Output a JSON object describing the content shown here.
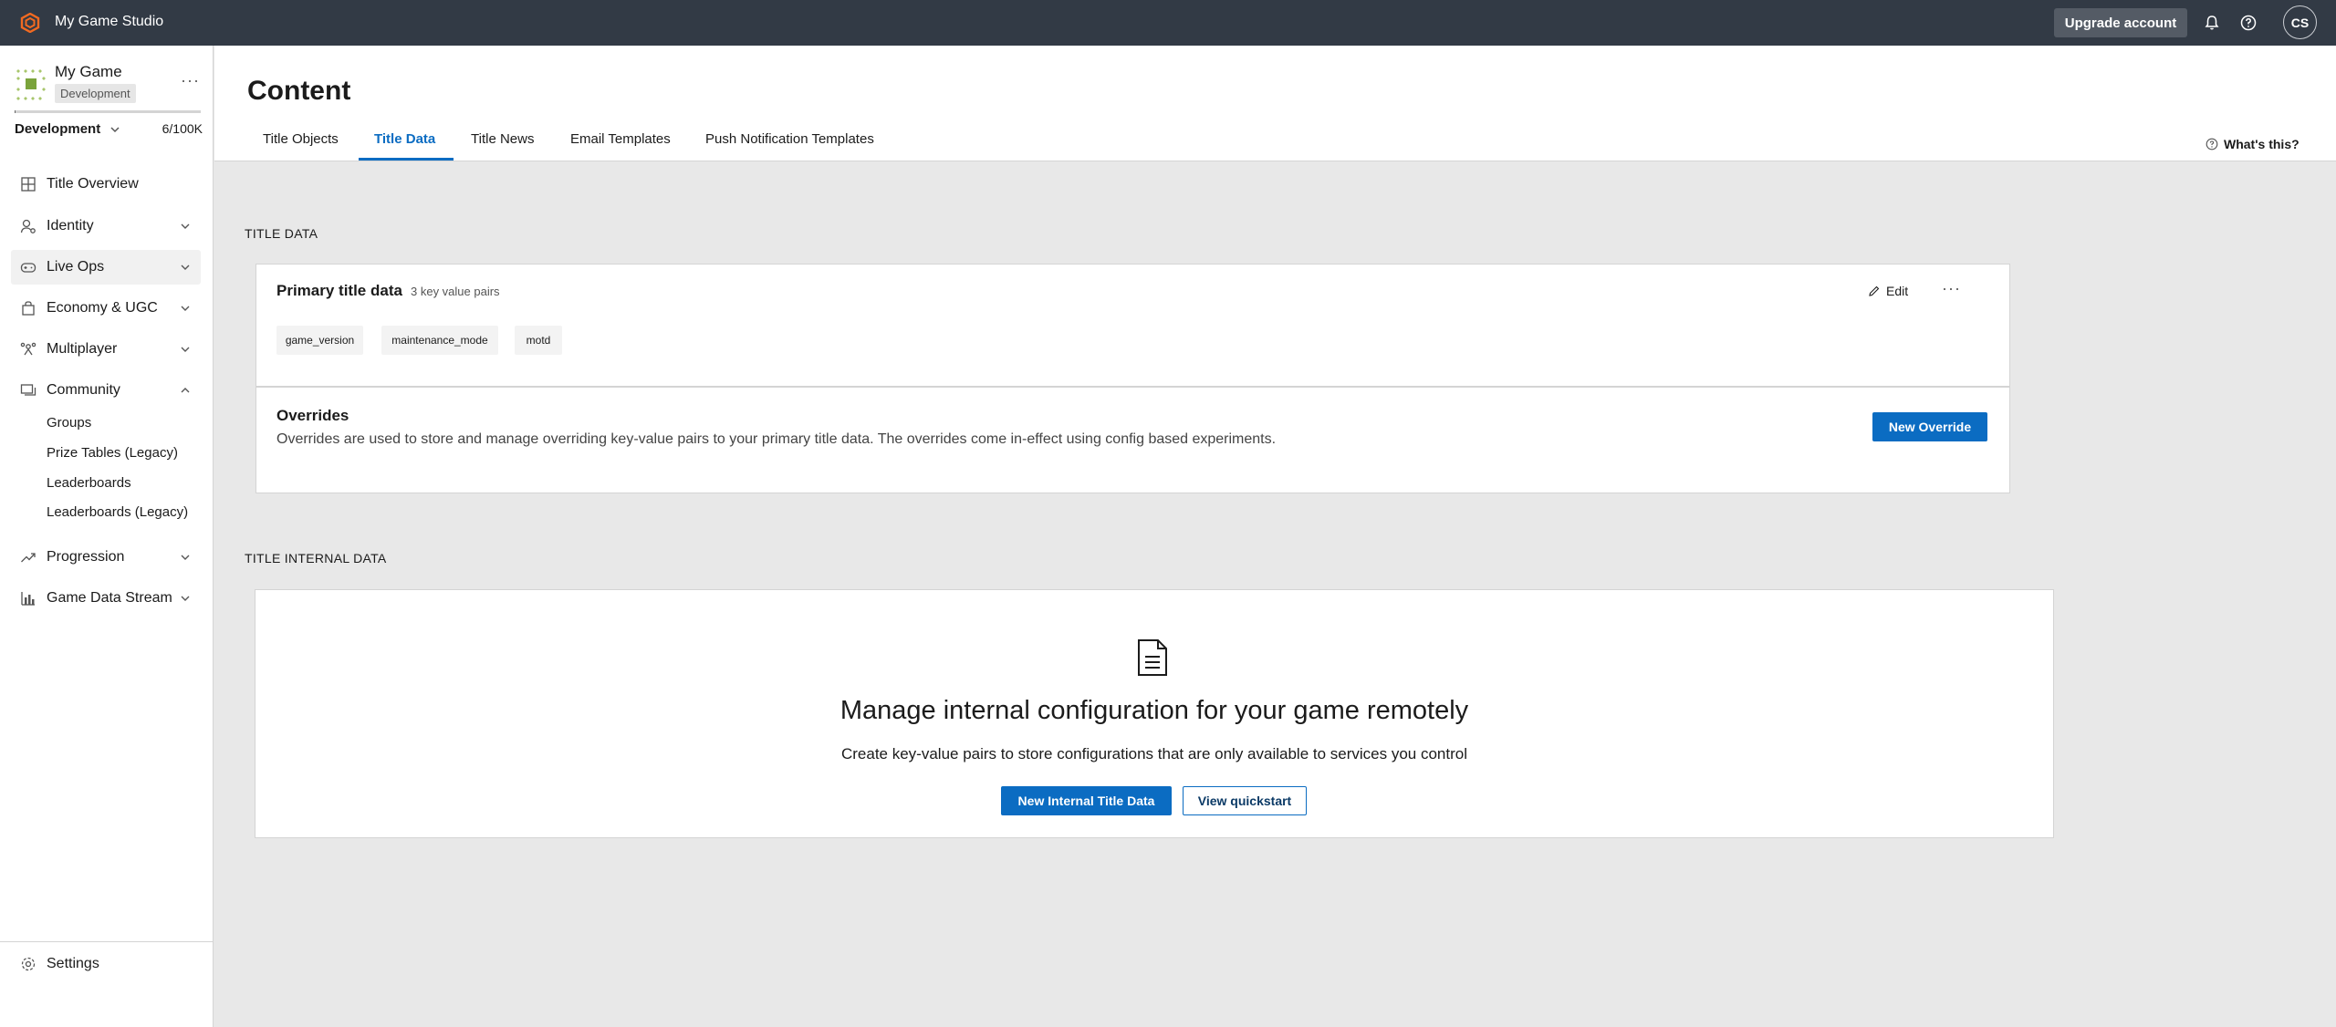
{
  "topbar": {
    "studio_name": "My Game Studio",
    "upgrade_label": "Upgrade account",
    "avatar_initials": "CS",
    "icons": [
      "studio-logo-icon",
      "bell-icon",
      "help-icon"
    ]
  },
  "sidebar": {
    "game_name": "My Game",
    "env_badge": "Development",
    "env_select": "Development",
    "quota": "6/100K",
    "quota_fraction": 6e-05,
    "nav": [
      {
        "label": "Title Overview",
        "icon": "grid-icon"
      },
      {
        "label": "Identity",
        "icon": "identity-icon"
      },
      {
        "label": "Live Ops",
        "icon": "gamepad-icon"
      },
      {
        "label": "Economy & UGC",
        "icon": "bag-icon"
      },
      {
        "label": "Multiplayer",
        "icon": "multiplayer-icon"
      },
      {
        "label": "Community",
        "icon": "community-icon"
      },
      {
        "label": "Progression",
        "icon": "trend-icon"
      },
      {
        "label": "Game Data Stream",
        "icon": "bar-chart-icon"
      }
    ],
    "community_sub": [
      "Groups",
      "Prize Tables (Legacy)",
      "Leaderboards",
      "Leaderboards (Legacy)"
    ],
    "settings_label": "Settings"
  },
  "header": {
    "title": "Content",
    "tabs": [
      "Title Objects",
      "Title Data",
      "Title News",
      "Email Templates",
      "Push Notification Templates"
    ],
    "active_tab": "Title Data",
    "whats_this": "What's this?"
  },
  "title_data": {
    "section_label": "TITLE DATA",
    "primary_title": "Primary title data",
    "pair_count": "3 key value pairs",
    "edit_label": "Edit",
    "keys": [
      "game_version",
      "maintenance_mode",
      "motd"
    ],
    "overrides_title": "Overrides",
    "overrides_desc": "Overrides are used to store and manage overriding key-value pairs to your primary title data. The overrides come in-effect using config based experiments.",
    "new_override_label": "New Override"
  },
  "internal_data": {
    "section_label": "TITLE INTERNAL DATA",
    "empty_title": "Manage internal configuration for your game remotely",
    "empty_desc": "Create key-value pairs to store configurations that are only available to services you control",
    "new_button": "New Internal Title Data",
    "quickstart_button": "View quickstart"
  },
  "colors": {
    "topbar": "#323a45",
    "accent": "#0b6cc2",
    "brand_logo": "#f26a21"
  }
}
